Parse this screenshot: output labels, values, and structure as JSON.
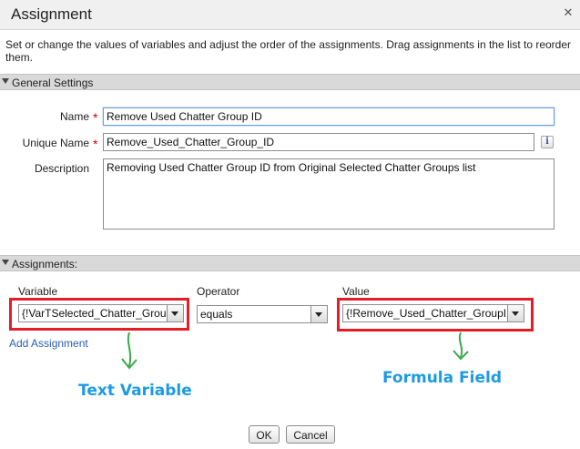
{
  "dialog": {
    "title": "Assignment",
    "close_glyph": "✕",
    "close_icon": "close-icon",
    "intro": "Set or change the values of variables and adjust the order of the assignments. Drag assignments in the list to reorder them."
  },
  "general": {
    "section_label": "General Settings",
    "name_label": "Name",
    "name_value": "Remove Used Chatter Group ID",
    "unique_label": "Unique Name",
    "unique_value": "Remove_Used_Chatter_Group_ID",
    "required_mark": "*",
    "info_glyph": "i",
    "description_label": "Description",
    "description_value": "Removing Used Chatter Group ID from Original Selected Chatter Groups list"
  },
  "assignments": {
    "section_label": "Assignments:",
    "variable_label": "Variable",
    "operator_label": "Operator",
    "value_label": "Value",
    "variable_value": "{!VarTSelected_Chatter_Grou",
    "operator_value": "equals",
    "value_value": "{!Remove_Used_Chatter_GroupID",
    "add_link": "Add Assignment"
  },
  "annotations": {
    "text_variable": "Text Variable",
    "formula_field": "Formula Field",
    "color": "#1d9be0",
    "arrow_color": "#3aa84a",
    "box_color": "#e41e26"
  },
  "footer": {
    "ok_label": "OK",
    "cancel_label": "Cancel"
  }
}
